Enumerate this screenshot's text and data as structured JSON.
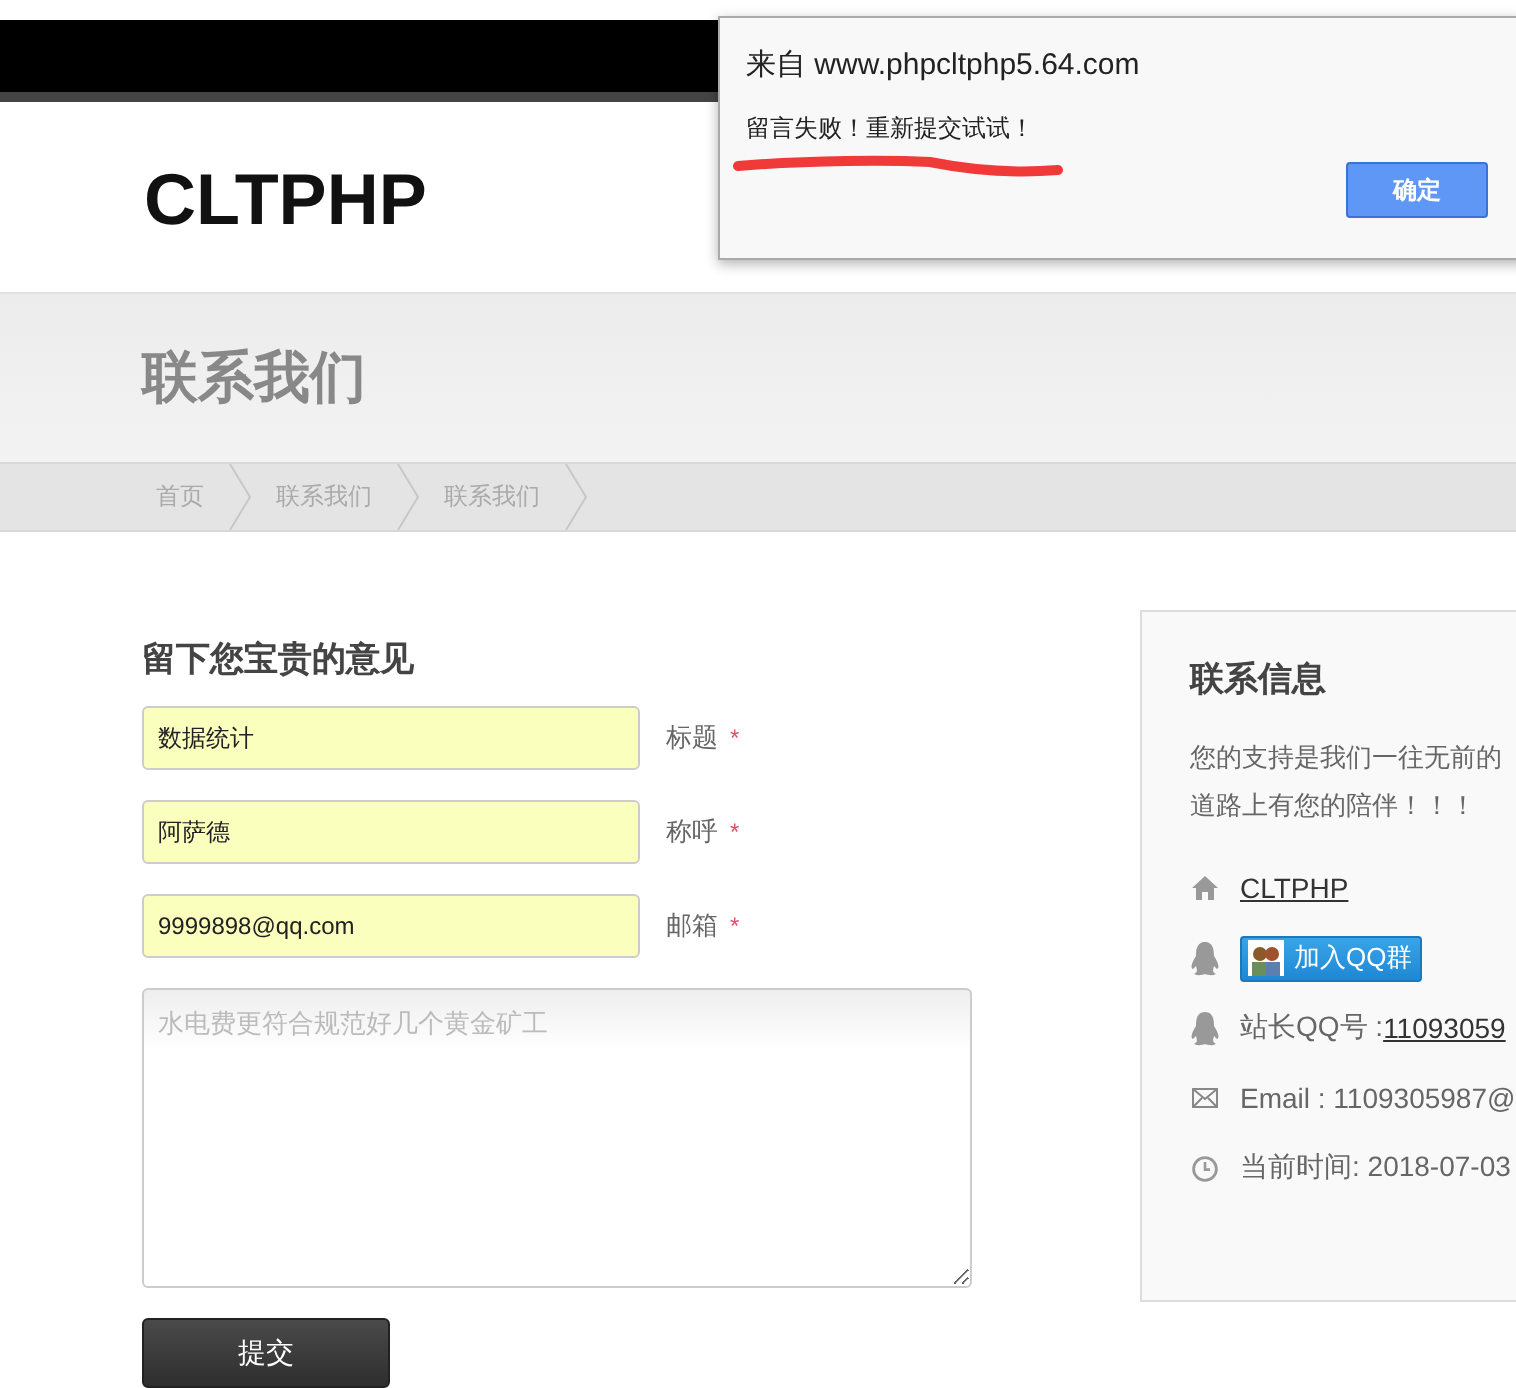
{
  "logo": "CLTPHP",
  "page_title": "联系我们",
  "breadcrumb": [
    "首页",
    "联系我们",
    "联系我们"
  ],
  "form": {
    "heading": "留下您宝贵的意见",
    "fields": [
      {
        "value": "数据统计",
        "label": "标题",
        "required_mark": "*"
      },
      {
        "value": "阿萨德",
        "label": "称呼",
        "required_mark": "*"
      },
      {
        "value": "9999898@qq.com",
        "label": "邮箱",
        "required_mark": "*"
      }
    ],
    "message": {
      "placeholder": "水电费更符合规范好几个黄金矿工"
    },
    "submit": "提交"
  },
  "contact": {
    "heading": "联系信息",
    "intro": [
      "您的支持是我们一往无前的",
      "道路上有您的陪伴！！！"
    ],
    "items": [
      {
        "kind": "link",
        "text": "CLTPHP"
      },
      {
        "kind": "qq_group",
        "text": "加入QQ群"
      },
      {
        "kind": "qq",
        "label": "站长QQ号 : ",
        "link": "11093059"
      },
      {
        "kind": "email",
        "text": "Email : 1109305987@"
      },
      {
        "kind": "time",
        "text": "当前时间: 2018-07-03"
      }
    ]
  },
  "dialog": {
    "title": "来自 www.phpcltphp5.64.com",
    "message": "留言失败！重新提交试试！",
    "button": "确定"
  }
}
